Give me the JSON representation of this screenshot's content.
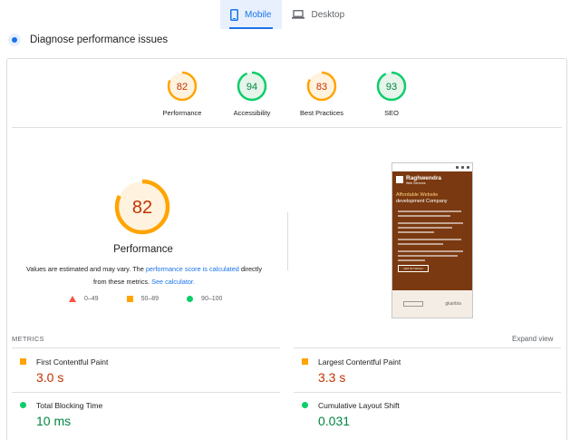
{
  "tabs": [
    {
      "label": "Mobile",
      "active": true
    },
    {
      "label": "Desktop",
      "active": false
    }
  ],
  "header": {
    "title": "Diagnose performance issues"
  },
  "gauges": [
    {
      "label": "Performance",
      "score": "82",
      "value": 0.82,
      "status": "average"
    },
    {
      "label": "Accessibility",
      "score": "94",
      "value": 0.94,
      "status": "pass"
    },
    {
      "label": "Best Practices",
      "score": "83",
      "value": 0.83,
      "status": "average"
    },
    {
      "label": "SEO",
      "score": "93",
      "value": 0.93,
      "status": "pass"
    }
  ],
  "main_gauge": {
    "score": "82",
    "value": 0.82,
    "label": "Performance"
  },
  "values_note": {
    "part1": "Values are estimated and may vary. The ",
    "link1": "performance score is calculated",
    "part2": " directly from these metrics. ",
    "link2": "See calculator."
  },
  "legend": [
    {
      "range": "0–49",
      "shape": "triangle",
      "color": "#ff4e42"
    },
    {
      "range": "50–89",
      "shape": "square",
      "color": "#ffa400"
    },
    {
      "range": "90–100",
      "shape": "circle",
      "color": "#0cce6b"
    }
  ],
  "screenshot": {
    "brand": "Raghwendra",
    "brand_sub": "Web Services",
    "headline_1": "Affordable Website",
    "headline_2": "development Company",
    "button": "GET IN TOUCH",
    "footer_right": "gkanbia"
  },
  "metrics": {
    "header": "METRICS",
    "expand": "Expand view",
    "items": [
      {
        "name": "First Contentful Paint",
        "value": "3.0 s",
        "status": "average"
      },
      {
        "name": "Largest Contentful Paint",
        "value": "3.3 s",
        "status": "average"
      },
      {
        "name": "Total Blocking Time",
        "value": "10 ms",
        "status": "pass"
      },
      {
        "name": "Cumulative Layout Shift",
        "value": "0.031",
        "status": "pass"
      }
    ]
  },
  "colors": {
    "accent": "#1a73e8",
    "average_stroke": "#ffa400",
    "average_fill": "#fff3e0",
    "average_text": "#c33300",
    "pass_stroke": "#0cce6b",
    "pass_fill": "#e6f4ea",
    "pass_text": "#018642",
    "fail": "#ff4e42"
  }
}
